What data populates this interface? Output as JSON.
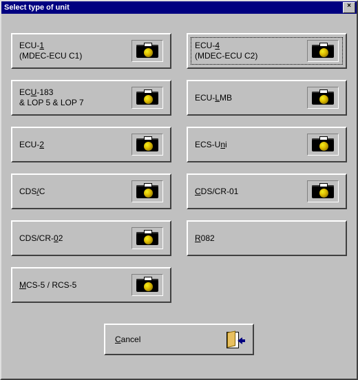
{
  "window": {
    "title": "Select type of unit",
    "close": "×"
  },
  "units": [
    {
      "id": "ecu-1",
      "line1_pre": "ECU-",
      "line1_u": "1",
      "line1_post": "",
      "line2": "(MDEC-ECU C1)",
      "has_icon": true,
      "focused": false
    },
    {
      "id": "ecu-4",
      "line1_pre": "ECU-",
      "line1_u": "4",
      "line1_post": "",
      "line2": "(MDEC-ECU C2)",
      "has_icon": true,
      "focused": true
    },
    {
      "id": "ecu-183",
      "line1_pre": "EC",
      "line1_u": "U",
      "line1_post": "-183",
      "line2": "& LOP 5 & LOP 7",
      "has_icon": true,
      "focused": false
    },
    {
      "id": "ecu-lmb",
      "line1_pre": "ECU-",
      "line1_u": "L",
      "line1_post": "MB",
      "line2": "",
      "has_icon": true,
      "focused": false
    },
    {
      "id": "ecu-2",
      "line1_pre": "ECU-",
      "line1_u": "2",
      "line1_post": "",
      "line2": "",
      "has_icon": true,
      "focused": false
    },
    {
      "id": "ecs-uni",
      "line1_pre": "ECS-U",
      "line1_u": "n",
      "line1_post": "i",
      "line2": "",
      "has_icon": true,
      "focused": false
    },
    {
      "id": "cds-c",
      "line1_pre": "CDS",
      "line1_u": "/",
      "line1_post": "C",
      "line2": "",
      "has_icon": true,
      "focused": false
    },
    {
      "id": "cds-cr01",
      "line1_pre": "",
      "line1_u": "C",
      "line1_post": "DS/CR-01",
      "line2": "",
      "has_icon": true,
      "focused": false
    },
    {
      "id": "cds-cr02",
      "line1_pre": "CDS/CR-",
      "line1_u": "0",
      "line1_post": "2",
      "line2": "",
      "has_icon": true,
      "focused": false
    },
    {
      "id": "r082",
      "line1_pre": "",
      "line1_u": "R",
      "line1_post": "082",
      "line2": "",
      "has_icon": false,
      "focused": false
    },
    {
      "id": "mcs-5",
      "line1_pre": "",
      "line1_u": "M",
      "line1_post": "CS-5 / RCS-5",
      "line2": "",
      "has_icon": true,
      "focused": false
    }
  ],
  "cancel": {
    "pre": "",
    "u": "C",
    "post": "ancel"
  }
}
